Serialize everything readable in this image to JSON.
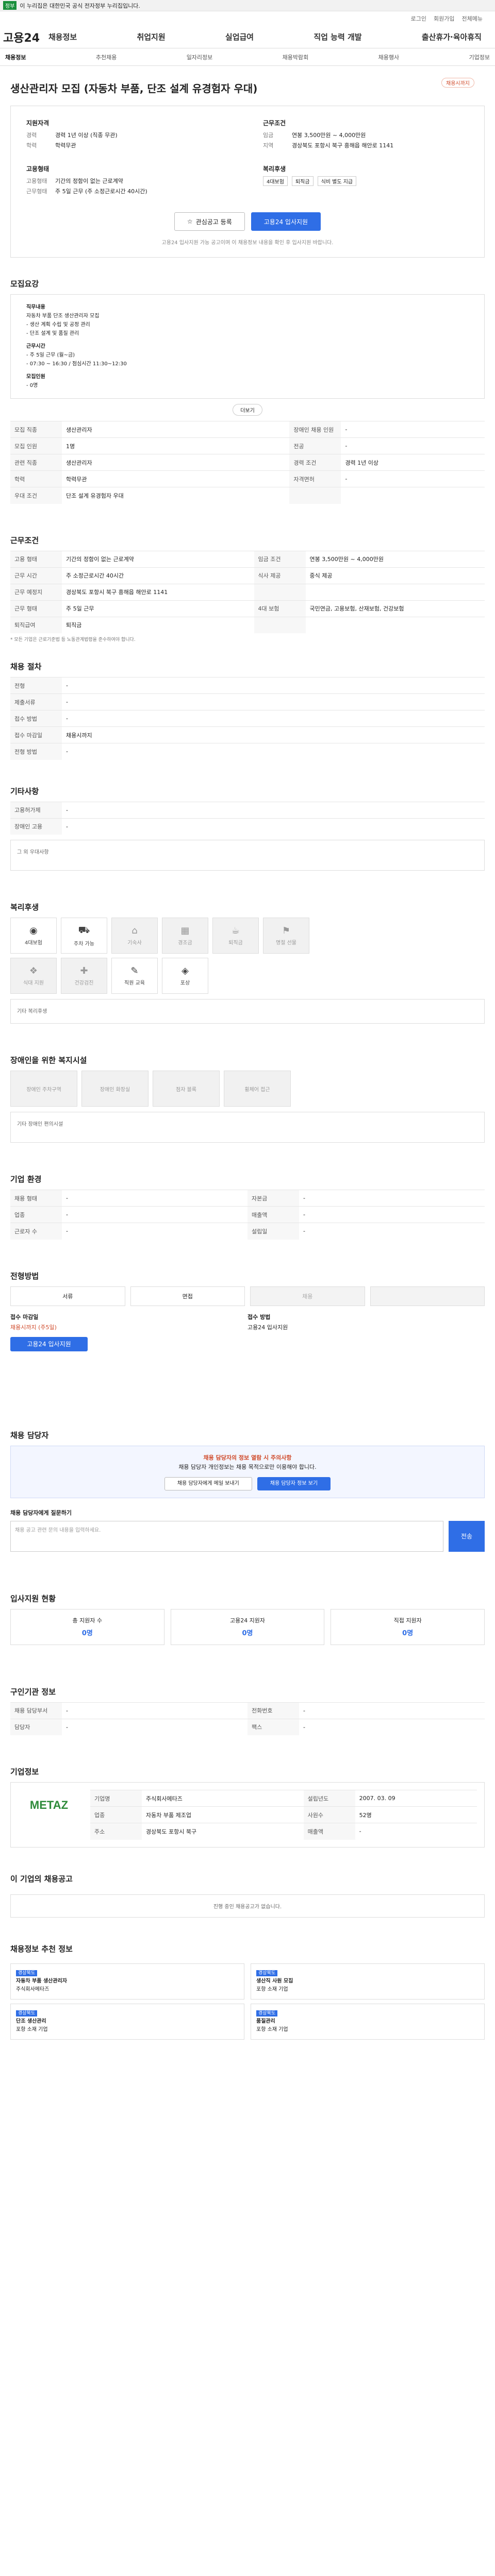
{
  "topbar": {
    "gov": "이 누리집은 대한민국 공식 전자정부 누리집입니다."
  },
  "util": [
    "로그인",
    "회원가입",
    "전체메뉴"
  ],
  "gnb": {
    "logo": "고용24",
    "menu": [
      "채용정보",
      "취업지원",
      "실업급여",
      "직업 능력 개발",
      "출산휴가·육아휴직"
    ]
  },
  "sub": [
    "채용정보",
    "채용정보",
    "추천채용",
    "일자리정보",
    "채용박람회",
    "채용행사",
    "기업정보"
  ],
  "job": {
    "title": "생산관리자 모집 (자동차 부품, 단조 설계 유경험자 우대)",
    "badge": "채용시까지",
    "left_h": "지원자격",
    "left": [
      [
        "경력",
        "경력 1년 이상 (직종 무관)"
      ],
      [
        "학력",
        "학력무관"
      ]
    ],
    "right_h": "근무조건",
    "right": [
      [
        "임금",
        "연봉 3,500만원 ~ 4,000만원"
      ],
      [
        "지역",
        "경상북도 포항시 북구 흥해읍 해안로 1141"
      ]
    ],
    "form_h": "고용형태",
    "form": [
      [
        "고용형태",
        "기간의 정함이 없는 근로계약"
      ],
      [
        "근무형태",
        "주 5일 근무 (주 소정근로시간 40시간)"
      ]
    ],
    "welfare_h": "복리후생",
    "chips": [
      "4대보험",
      "퇴직금",
      "식비 별도 지급"
    ],
    "btn_save": "관심공고 등록",
    "btn_apply": "고용24 입사지원",
    "note": "고용24 입사지원 가능 공고이며 이 채용정보 내용을 확인 후 입사지원 바랍니다."
  },
  "s1": {
    "h": "모집요강",
    "intro": [
      "직무내용",
      "자동차 부품 단조 생산관리자 모집",
      "- 생산 계획 수립 및 공정 관리",
      "- 단조 설계 및 품질 관리",
      "근무시간",
      "- 주 5일 근무 (월~금)",
      "- 07:30 ~ 16:30 / 점심시간 11:30~12:30",
      "모집인원",
      "- 0명"
    ],
    "rows": [
      [
        "모집 직종",
        "생산관리자",
        "장애인 채용 인원",
        "-"
      ],
      [
        "모집 인원",
        "1명",
        "전공",
        "-"
      ],
      [
        "관련 직종",
        "생산관리자",
        "경력 조건",
        "경력 1년 이상"
      ],
      [
        "학력",
        "학력무관",
        "자격면허",
        "-"
      ],
      [
        "우대 조건",
        "단조 설계 유경험자 우대",
        "",
        ""
      ]
    ],
    "more": "더보기"
  },
  "s2": {
    "h": "근무조건",
    "rows": [
      [
        "고용 형태",
        "기간의 정함이 없는 근로계약",
        "임금 조건",
        "연봉 3,500만원 ~ 4,000만원"
      ],
      [
        "근무 시간",
        "주 소정근로시간 40시간",
        "식사 제공",
        "중식 제공"
      ],
      [
        "근무 예정지",
        "경상북도 포항시 북구 흥해읍 해안로 1141",
        "",
        ""
      ],
      [
        "근무 형태",
        "주 5일 근무",
        "4대 보험",
        "국민연금, 고용보험, 산재보험, 건강보험"
      ],
      [
        "퇴직급여",
        "퇴직금",
        "",
        ""
      ]
    ],
    "note": "* 모든 기업은 근로기준법 등 노동관계법령을 준수하여야 합니다."
  },
  "s3": {
    "h": "채용 절차",
    "rows": [
      [
        "전형",
        "-"
      ],
      [
        "제출서류",
        "-"
      ],
      [
        "접수 방법",
        "-"
      ],
      [
        "접수 마감일",
        "채용시까지"
      ],
      [
        "전형 방법",
        "-"
      ]
    ]
  },
  "s4": {
    "h": "기타사항",
    "rows": [
      [
        "고용허가제",
        "-"
      ],
      [
        "장애인 고용",
        "-"
      ]
    ],
    "box": "그 외 우대사항"
  },
  "s5": {
    "h": "복리후생",
    "icons": [
      [
        "◉",
        "4대보험",
        0
      ],
      [
        "⛟",
        "주차 가능",
        0
      ],
      [
        "⌂",
        "기숙사",
        1
      ],
      [
        "▦",
        "경조금",
        1
      ],
      [
        "☕",
        "퇴직금",
        1
      ],
      [
        "⚑",
        "명절 선물",
        1
      ],
      [
        "❖",
        "식대 지원",
        1
      ],
      [
        "✚",
        "건강검진",
        1
      ],
      [
        "✎",
        "직원 교육",
        0
      ],
      [
        "◈",
        "포상",
        0
      ]
    ],
    "note": "기타 복리후생"
  },
  "s6": {
    "h": "장애인을 위한 복지시설",
    "icons": [
      "장애인 주차구역",
      "장애인 화장실",
      "점자 블록",
      "휠체어 접근"
    ],
    "box": "기타 장애인 편의시설"
  },
  "s7": {
    "h": "기업 환경",
    "rows": [
      [
        "채용 형태",
        "-",
        "자본금",
        "-"
      ],
      [
        "업종",
        "-",
        "매출액",
        "-"
      ],
      [
        "근로자 수",
        "-",
        "설립일",
        "-"
      ]
    ]
  },
  "s8": {
    "h": "전형방법",
    "steps": [
      "서류",
      "면접",
      "채용"
    ],
    "apply_l": [
      "접수 마감일",
      "채용시까지 (주5일)",
      "고용24 입사지원"
    ],
    "apply_r": [
      "접수 방법",
      "고용24 입사지원"
    ]
  },
  "s9": {
    "h": "채용 담당자",
    "blue": [
      "채용 담당자의 정보 열람 시 주의사항",
      "채용 담당자 개인정보는 채용 목적으로만 이용해야 합니다."
    ],
    "btn1": "채용 담당자에게 메일 보내기",
    "btn2": "채용 담당자 정보 보기",
    "ta_h": "채용 담당자에게 질문하기",
    "ta_ph": "채용 공고 관련 문의 내용을 입력하세요.",
    "send": "전송"
  },
  "s10": {
    "h": "입사지원 현황",
    "stats": [
      [
        "총 지원자 수",
        "0명"
      ],
      [
        "고용24 지원자",
        "0명"
      ],
      [
        "직접 지원자",
        "0명"
      ]
    ]
  },
  "s11": {
    "h": "구인기관 정보",
    "rows": [
      [
        "채용 담당부서",
        "-",
        "전화번호",
        "-"
      ],
      [
        "담당자",
        "-",
        "팩스",
        "-"
      ]
    ]
  },
  "s12": {
    "h": "기업정보",
    "logo": "METAZ",
    "rows": [
      [
        "기업명",
        "주식회사메타즈",
        "설립년도",
        "2007. 03. 09"
      ],
      [
        "업종",
        "자동차 부품 제조업",
        "사원수",
        "52명"
      ],
      [
        "주소",
        "경상북도 포항시 북구",
        "매출액",
        "-"
      ]
    ]
  },
  "s13": {
    "h": "이 기업의 채용공고",
    "empty": "진행 중인 채용공고가 없습니다."
  },
  "s14": {
    "h": "채용정보 추천 정보",
    "jobs": [
      [
        "경상북도",
        "자동차 부품 생산관리자",
        "주식회사메타즈"
      ],
      [
        "경상북도",
        "생산직 사원 모집",
        "포항 소재 기업"
      ],
      [
        "경상북도",
        "단조 생산관리",
        "포항 소재 기업"
      ],
      [
        "경상북도",
        "품질관리",
        "포항 소재 기업"
      ]
    ]
  }
}
